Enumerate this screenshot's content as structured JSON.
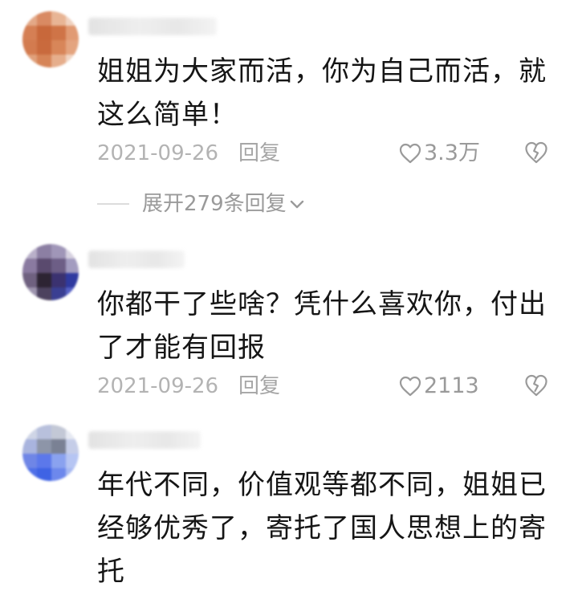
{
  "comments": [
    {
      "text": "姐姐为大家而活，你为自己而活，就\n这么简单！",
      "date": "2021-09-26",
      "reply_label": "回复",
      "likes": "3.3万",
      "expand_label": "展开279条回复"
    },
    {
      "text": "你都干了些啥？凭什么喜欢你，付出\n了才能有回报",
      "date": "2021-09-26",
      "reply_label": "回复",
      "likes": "2113"
    },
    {
      "text": "年代不同，价值观等都不同，姐姐已\n经够优秀了，寄托了国人思想上的寄\n托"
    }
  ],
  "icons": {
    "like": "heart-outline-icon",
    "dislike": "broken-heart-icon",
    "expand": "chevron-down-icon"
  },
  "colors": {
    "text": "#151515",
    "meta": "#b3b3b3",
    "icon": "#9a9a9a"
  }
}
